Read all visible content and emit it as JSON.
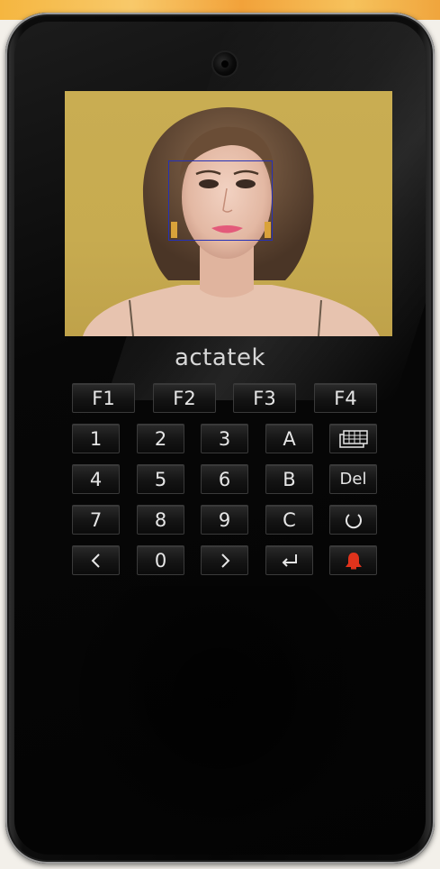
{
  "brand": {
    "name": "actatek"
  },
  "function_keys": [
    {
      "label": "F1"
    },
    {
      "label": "F2"
    },
    {
      "label": "F3"
    },
    {
      "label": "F4"
    }
  ],
  "keypad": {
    "row1": [
      "1",
      "2",
      "3",
      "A"
    ],
    "row2": [
      "4",
      "5",
      "6",
      "B",
      "Del"
    ],
    "row3": [
      "7",
      "8",
      "9",
      "C"
    ],
    "row4_zero": "0"
  },
  "icons": {
    "keyboard": "keyboard-icon",
    "refresh": "refresh-icon",
    "left": "arrow-left-icon",
    "right": "arrow-right-icon",
    "enter": "enter-icon",
    "alarm": "bell-icon"
  },
  "colors": {
    "face_frame": "#2531b8",
    "alarm": "#e0331c",
    "screen_background": "#c9ad52"
  }
}
